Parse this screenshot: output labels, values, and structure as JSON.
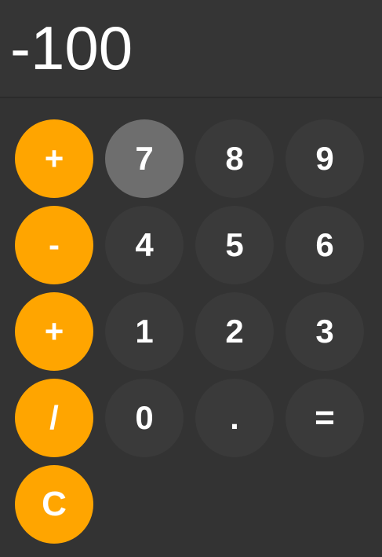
{
  "display": {
    "value": "-100"
  },
  "operators": {
    "add_top": "+",
    "subtract": "-",
    "add": "+",
    "divide": "/",
    "clear": "C"
  },
  "digits": {
    "d7": "7",
    "d8": "8",
    "d9": "9",
    "d4": "4",
    "d5": "5",
    "d6": "6",
    "d1": "1",
    "d2": "2",
    "d3": "3",
    "d0": "0",
    "decimal": ".",
    "equals": "="
  },
  "colors": {
    "operator": "#FFA500",
    "digit": "#3a3a3a",
    "digit_active": "#6e6e6e",
    "background": "#333333",
    "text": "#ffffff"
  },
  "state": {
    "pressed_key": "7"
  }
}
